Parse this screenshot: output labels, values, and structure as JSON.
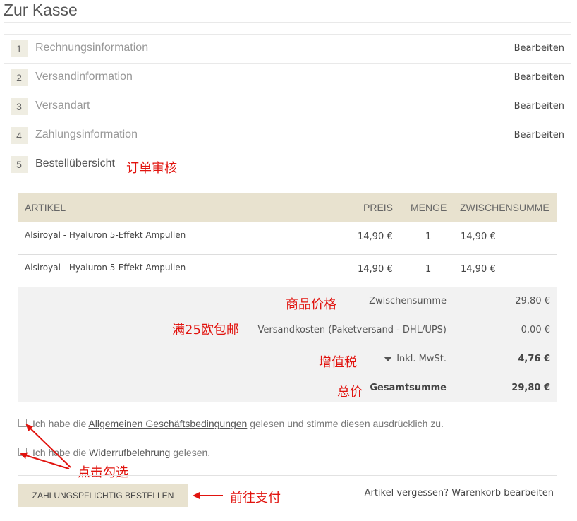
{
  "page": {
    "title": "Zur Kasse"
  },
  "steps": [
    {
      "num": "1",
      "label": "Rechnungsinformation",
      "edit": "Bearbeiten"
    },
    {
      "num": "2",
      "label": "Versandinformation",
      "edit": "Bearbeiten"
    },
    {
      "num": "3",
      "label": "Versandart",
      "edit": "Bearbeiten"
    },
    {
      "num": "4",
      "label": "Zahlungsinformation",
      "edit": "Bearbeiten"
    },
    {
      "num": "5",
      "label": "Bestellübersicht"
    }
  ],
  "annotations": {
    "order_review": "订单审核",
    "goods_price": "商品价格",
    "free_shipping": "满25欧包邮",
    "vat": "增值税",
    "total": "总价",
    "click_check": "点击勾选",
    "go_pay": "前往支付",
    "color": "#e1140f"
  },
  "table": {
    "headers": {
      "article": "ARTIKEL",
      "price": "PREIS",
      "qty": "MENGE",
      "subtotal": "ZWISCHENSUMME"
    },
    "rows": [
      {
        "name": "Alsiroyal - Hyaluron 5-Effekt Ampullen",
        "price": "14,90 €",
        "qty": "1",
        "subtotal": "14,90 €"
      },
      {
        "name": "Alsiroyal - Hyaluron 5-Effekt Ampullen",
        "price": "14,90 €",
        "qty": "1",
        "subtotal": "14,90 €"
      }
    ],
    "totals": {
      "subtotal_label": "Zwischensumme",
      "subtotal_value": "29,80 €",
      "shipping_label": "Versandkosten (Paketversand - DHL/UPS)",
      "shipping_value": "0,00 €",
      "tax_label": "Inkl. MwSt.",
      "tax_value": "4,76 €",
      "grand_label": "Gesamtsumme",
      "grand_value": "29,80 €"
    }
  },
  "agreements": {
    "terms_pre": "Ich habe die ",
    "terms_link": "Allgemeinen Geschäftsbedingungen",
    "terms_post": " gelesen und stimme diesen ausdrücklich zu.",
    "withdrawal_pre": "Ich habe die ",
    "withdrawal_link": "Widerrufbelehrung",
    "withdrawal_post": " gelesen."
  },
  "actions": {
    "order_button": "ZAHLUNGSPFLICHTIG BESTELLEN",
    "forgot_link": "Artikel vergessen? Warenkorb bearbeiten"
  },
  "colors": {
    "accent_beige": "#e8e2cf",
    "annotation_red": "#e1140f"
  }
}
